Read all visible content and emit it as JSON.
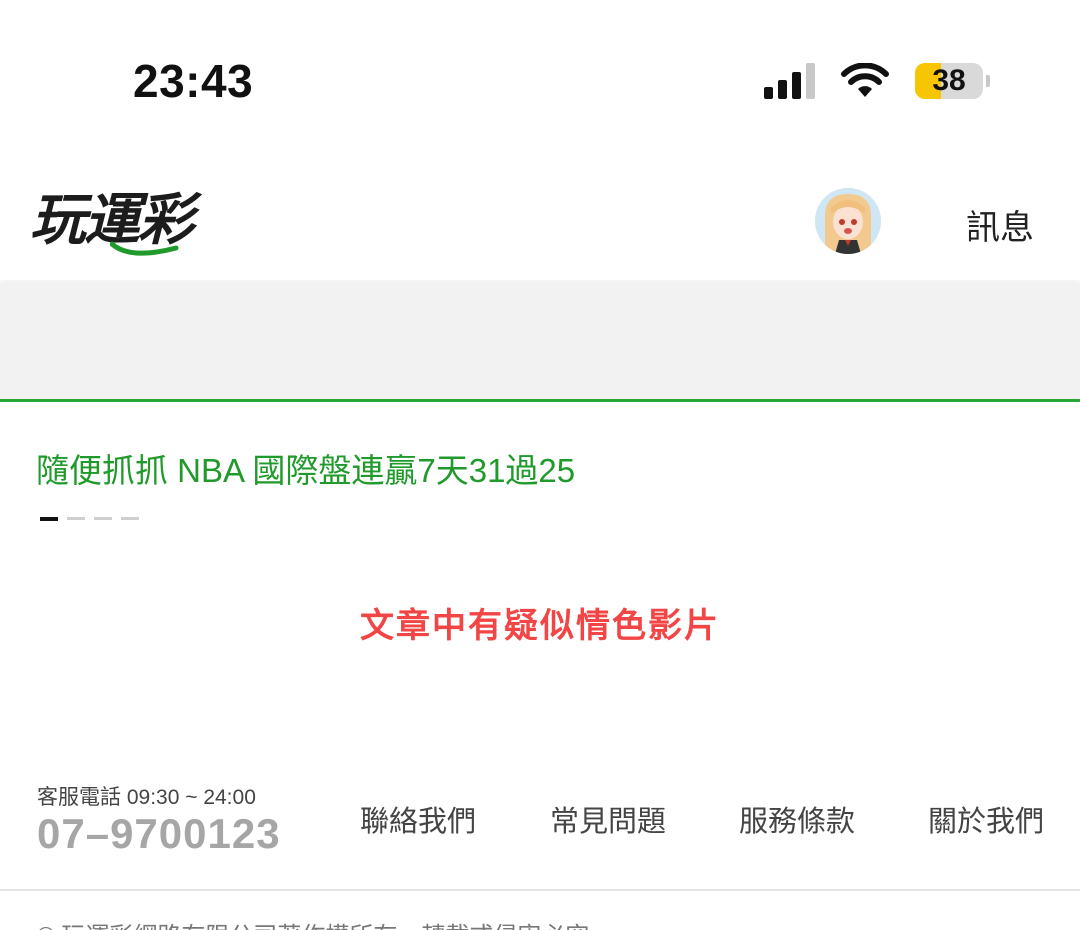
{
  "status_bar": {
    "time": "23:43",
    "battery_level": "38",
    "battery_fraction": 0.38,
    "icons": [
      "cellular-signal-icon",
      "wifi-icon",
      "battery-icon"
    ]
  },
  "header": {
    "logo_text": "玩運彩",
    "avatar_label": "user-avatar",
    "messages_label": "訊息"
  },
  "article": {
    "title": "隨便抓抓 NBA 國際盤連贏7天31過25",
    "page_count": 4,
    "active_page": 1,
    "warning": "文章中有疑似情色影片"
  },
  "footer": {
    "hotline_label": "客服電話 09:30 ~ 24:00",
    "hotline_number": "07–9700123",
    "links": [
      "聯絡我們",
      "常見問題",
      "服務條款",
      "關於我們"
    ],
    "copyright": "© 玩運彩網路有限公司著作權所有，轉載或侵害必究。"
  },
  "colors": {
    "brand_green": "#1f9a2b",
    "divider_green": "#27a834",
    "warning_red": "#f24545",
    "battery_yellow": "#f7c600"
  }
}
